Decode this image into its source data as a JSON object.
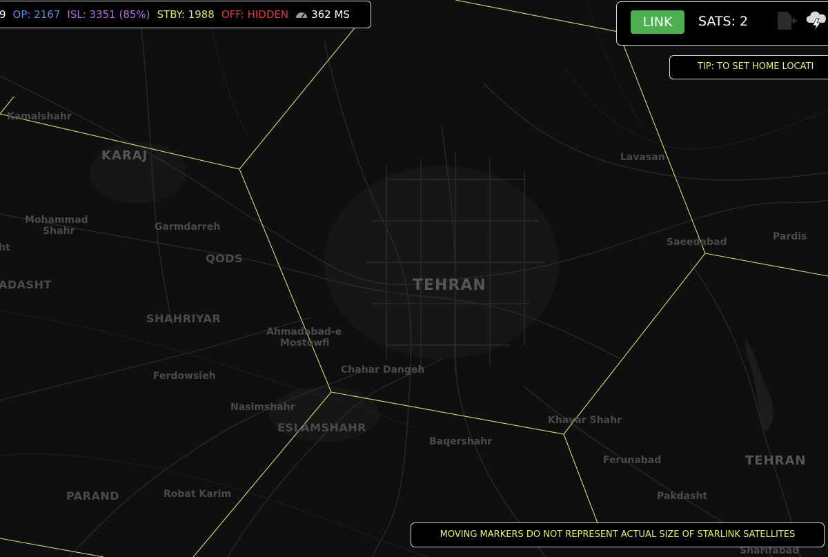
{
  "stats": {
    "total_fragment": "9",
    "operational": "OP: 2167",
    "isl": "ISL: 3351 (85%)",
    "standby": "STBY: 1988",
    "off": "OFF: HIDDEN",
    "latency": "362 MS"
  },
  "controls": {
    "link_label": "LINK",
    "sats_label": "SATS: 2",
    "export_icon": "export-arrow-icon",
    "weather_icon": "cloud-lightning-icon"
  },
  "tip": "TIP: TO SET HOME LOCATI",
  "notice": "MOVING MARKERS DO NOT REPRESENT ACTUAL SIZE OF STARLINK SATELLITES",
  "colors": {
    "operational": "#5b8fd6",
    "isl": "#b46ce0",
    "standby": "#d9e36b",
    "off": "#e03a3a",
    "link": "#4caf50",
    "hex_grid": "#d6dc7a"
  },
  "places": {
    "kamalshahr": "Kamalshahr",
    "karaj": "KARAJ",
    "mohammad_shahr_1": "Mohammad",
    "mohammad_shahr_2": "Shahr",
    "garmdarreh": "Garmdarreh",
    "qods": "QODS",
    "adasht": "ADASHT",
    "ht": "ht",
    "shahriyar": "SHAHRIYAR",
    "ahmadabad_1": "Ahmadabad-e",
    "ahmadabad_2": "Mostowfi",
    "ferdowsieh": "Ferdowsieh",
    "chahar_dangeh": "Chahar Dangeh",
    "nasimshahr": "Nasimshahr",
    "eslamshahr": "ESLAMSHAHR",
    "baqershahr": "Baqershahr",
    "parand": "PARAND",
    "robat_karim": "Robat Karim",
    "tehran": "TEHRAN",
    "lavasan": "Lavasan",
    "saeedabad": "Saeedabad",
    "pardis": "Pardis",
    "khavar_shahr": "Khavar Shahr",
    "ferunabad": "Ferunabad",
    "pakdasht": "Pakdasht",
    "tehran_province": "TEHRAN",
    "sharifabad": "Sharifabad"
  }
}
